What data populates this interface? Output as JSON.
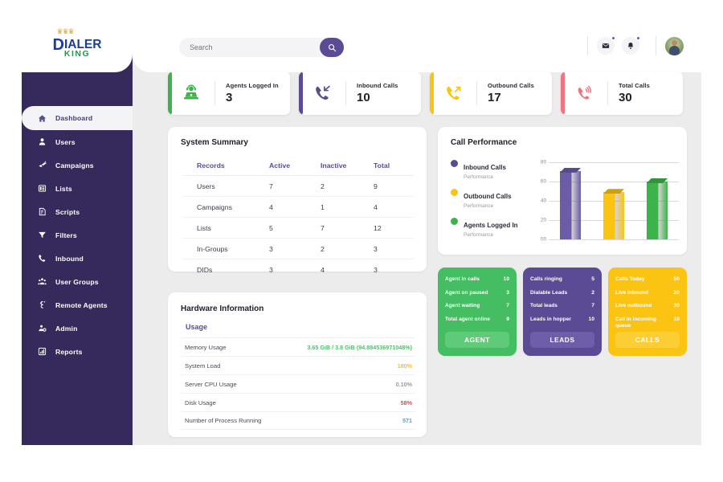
{
  "brand": {
    "logo_main": "IALER",
    "logo_initial": "D",
    "logo_sub": "KING",
    "crown_icon": "crown-icon",
    "sidebar_color": "#362A5C",
    "accent_color": "#5B4A94"
  },
  "sidebar": {
    "items": [
      {
        "label": "Dashboard",
        "icon": "home-icon",
        "active": true
      },
      {
        "label": "Users",
        "icon": "user-icon",
        "active": false
      },
      {
        "label": "Campaigns",
        "icon": "megaphone-icon",
        "active": false
      },
      {
        "label": "Lists",
        "icon": "list-icon",
        "active": false
      },
      {
        "label": "Scripts",
        "icon": "script-icon",
        "active": false
      },
      {
        "label": "Filters",
        "icon": "filter-icon",
        "active": false
      },
      {
        "label": "Inbound",
        "icon": "phone-icon",
        "active": false
      },
      {
        "label": "User Groups",
        "icon": "users-group-icon",
        "active": false
      },
      {
        "label": "Remote Agents",
        "icon": "remote-agent-icon",
        "active": false
      },
      {
        "label": "Admin",
        "icon": "admin-gear-icon",
        "active": false
      },
      {
        "label": "Reports",
        "icon": "bar-chart-icon",
        "active": false
      }
    ]
  },
  "topbar": {
    "search": {
      "placeholder": "Search",
      "value": "",
      "button_icon": "search-icon"
    },
    "mail_icon": "mail-icon",
    "bell_icon": "bell-icon",
    "mail_badge": true,
    "bell_badge": true,
    "avatar": "user-avatar"
  },
  "kpis": [
    {
      "label": "Agents Logged In",
      "value": "3",
      "color": "#3CB44A",
      "icon": "agent-desk-icon"
    },
    {
      "label": "Inbound Calls",
      "value": "10",
      "color": "#5B4A94",
      "icon": "phone-incoming-icon"
    },
    {
      "label": "Outbound Calls",
      "value": "17",
      "color": "#FBC312",
      "icon": "phone-outgoing-icon"
    },
    {
      "label": "Total Calls",
      "value": "30",
      "color": "#F0737F",
      "icon": "phone-ring-icon"
    }
  ],
  "system_summary": {
    "title": "System Summary",
    "columns": [
      "Records",
      "Active",
      "Inactive",
      "Total"
    ],
    "rows": [
      {
        "record": "Users",
        "active": "7",
        "inactive": "2",
        "total": "9"
      },
      {
        "record": "Campaigns",
        "active": "4",
        "inactive": "1",
        "total": "4"
      },
      {
        "record": "Lists",
        "active": "5",
        "inactive": "7",
        "total": "12"
      },
      {
        "record": "In-Groups",
        "active": "3",
        "inactive": "2",
        "total": "3"
      },
      {
        "record": "DIDs",
        "active": "3",
        "inactive": "4",
        "total": "3"
      }
    ]
  },
  "hardware": {
    "title": "Hardware Information",
    "subtitle": "Usage",
    "rows": [
      {
        "key": "Memory Usage",
        "value": "3.65 GiB / 3.8 GiB (94.884536971048%)",
        "color": "#4CC26A"
      },
      {
        "key": "System Load",
        "value": "180%",
        "color": "#FBC312"
      },
      {
        "key": "Server CPU Usage",
        "value": "0.10%",
        "color": "#9A9AA5"
      },
      {
        "key": "Disk Usage",
        "value": "58%",
        "color": "#F0434F"
      },
      {
        "key": "Number of Process Running",
        "value": "571",
        "color": "#3BA8E8"
      }
    ]
  },
  "chart_data": {
    "type": "bar",
    "title": "Call Performance",
    "categories": [
      "Inbound Calls",
      "Outbound Calls",
      "Agents Logged In"
    ],
    "values": [
      71,
      49,
      60
    ],
    "colors": [
      "#6B5BA8",
      "#FBC312",
      "#3CB44A"
    ],
    "xlabel": "",
    "ylabel": "",
    "ylim": [
      0,
      80
    ],
    "yticks": [
      "00",
      "20",
      "40",
      "60",
      "80"
    ],
    "grid": true,
    "legend_position": "left",
    "legend": [
      {
        "name": "Inbound Calls",
        "sub": "Performance",
        "color": "#5B4A94"
      },
      {
        "name": "Outbound Calls",
        "sub": "Performance",
        "color": "#FBC312"
      },
      {
        "name": "Agents Logged In",
        "sub": "Performance",
        "color": "#3CB44A"
      }
    ]
  },
  "stat_cards": [
    {
      "bg": "#45BD62",
      "btn_bg": "#5FCB78",
      "button": "AGENT",
      "lines": [
        {
          "key": "Agent in calls",
          "num": "10"
        },
        {
          "key": "Agent on paused",
          "num": "3"
        },
        {
          "key": "Agent waiting",
          "num": "7"
        },
        {
          "key": "Total agent online",
          "num": "9"
        }
      ]
    },
    {
      "bg": "#5B4A94",
      "btn_bg": "#6E5DA8",
      "button": "LEADS",
      "lines": [
        {
          "key": "Calls ringing",
          "num": "5"
        },
        {
          "key": "Dialable Leads",
          "num": "2"
        },
        {
          "key": "Total leads",
          "num": "7"
        },
        {
          "key": "Leads in hopper",
          "num": "10"
        }
      ]
    },
    {
      "bg": "#FBC312",
      "btn_bg": "#FCCE36",
      "button": "CALLS",
      "lines": [
        {
          "key": "Calls Today",
          "num": "50"
        },
        {
          "key": "Live inbound",
          "num": "20"
        },
        {
          "key": "Live outbound",
          "num": "30"
        },
        {
          "key": "Call in incoming queue",
          "num": "10"
        }
      ]
    }
  ]
}
